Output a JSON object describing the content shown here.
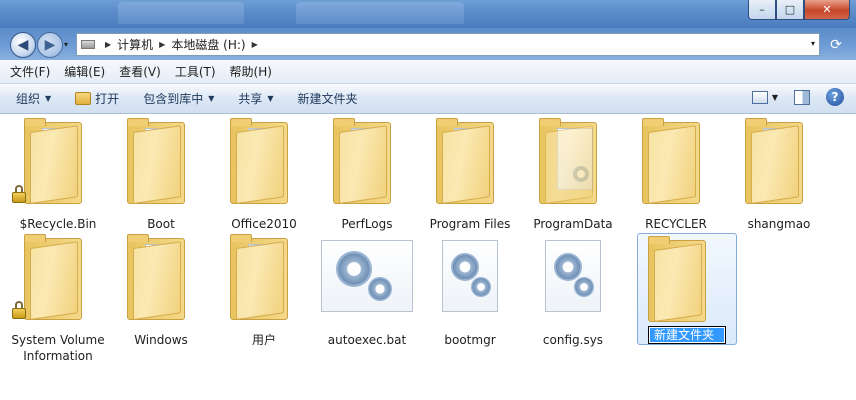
{
  "window": {
    "controls": {
      "minimize": "–",
      "maximize": "□",
      "close": "✕"
    }
  },
  "nav": {
    "back_glyph": "◀",
    "forward_glyph": "▶",
    "dropdown_glyph": "▾",
    "breadcrumb": [
      "计算机",
      "本地磁盘 (H:)"
    ],
    "refresh_glyph": "⟳"
  },
  "menu": [
    "文件(F)",
    "编辑(E)",
    "查看(V)",
    "工具(T)",
    "帮助(H)"
  ],
  "commands": {
    "organize": "组织",
    "open": "打开",
    "include": "包含到库中",
    "share": "共享",
    "new_folder": "新建文件夹",
    "help": "?"
  },
  "files": [
    {
      "name": "$Recycle.Bin",
      "type": "folder",
      "icon": "folder-lock-icon"
    },
    {
      "name": "Boot",
      "type": "folder",
      "icon": "folder-icon"
    },
    {
      "name": "Office2010",
      "type": "folder",
      "icon": "folder-icon"
    },
    {
      "name": "PerfLogs",
      "type": "folder",
      "icon": "folder-icon"
    },
    {
      "name": "Program Files",
      "type": "folder",
      "icon": "folder-icon"
    },
    {
      "name": "ProgramData",
      "type": "folder",
      "icon": "folder-icon"
    },
    {
      "name": "RECYCLER",
      "type": "folder",
      "icon": "folder-icon"
    },
    {
      "name": "shangmao",
      "type": "folder",
      "icon": "folder-icon"
    },
    {
      "name": "System Volume Information",
      "type": "folder",
      "icon": "folder-lock-icon"
    },
    {
      "name": "Windows",
      "type": "folder",
      "icon": "folder-icon"
    },
    {
      "name": "用户",
      "type": "folder",
      "icon": "folder-icon"
    },
    {
      "name": "autoexec.bat",
      "type": "file",
      "icon": "batch-file-icon"
    },
    {
      "name": "bootmgr",
      "type": "file",
      "icon": "system-file-icon"
    },
    {
      "name": "config.sys",
      "type": "file",
      "icon": "system-file-icon"
    },
    {
      "name": "新建文件夹",
      "type": "folder",
      "icon": "folder-icon",
      "selected": true,
      "renaming": true
    }
  ]
}
